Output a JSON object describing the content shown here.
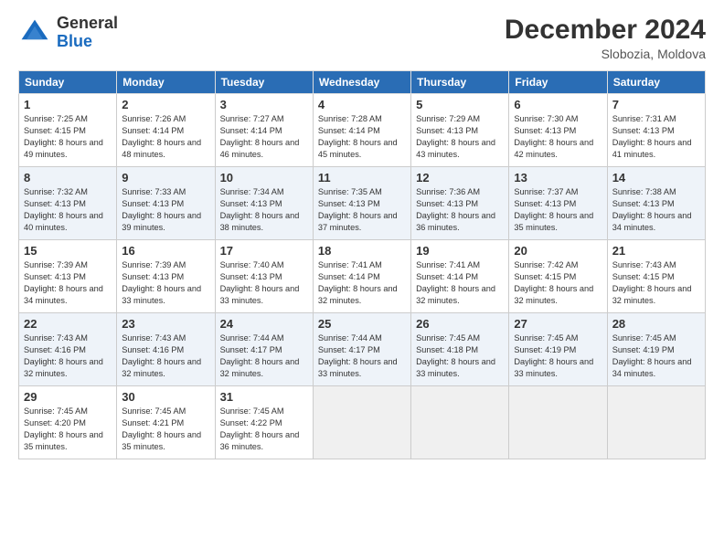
{
  "header": {
    "logo_line1": "General",
    "logo_line2": "Blue",
    "month": "December 2024",
    "location": "Slobozia, Moldova"
  },
  "days_of_week": [
    "Sunday",
    "Monday",
    "Tuesday",
    "Wednesday",
    "Thursday",
    "Friday",
    "Saturday"
  ],
  "weeks": [
    [
      {
        "day": 1,
        "sunrise": "7:25 AM",
        "sunset": "4:15 PM",
        "daylight": "8 hours and 49 minutes."
      },
      {
        "day": 2,
        "sunrise": "7:26 AM",
        "sunset": "4:14 PM",
        "daylight": "8 hours and 48 minutes."
      },
      {
        "day": 3,
        "sunrise": "7:27 AM",
        "sunset": "4:14 PM",
        "daylight": "8 hours and 46 minutes."
      },
      {
        "day": 4,
        "sunrise": "7:28 AM",
        "sunset": "4:14 PM",
        "daylight": "8 hours and 45 minutes."
      },
      {
        "day": 5,
        "sunrise": "7:29 AM",
        "sunset": "4:13 PM",
        "daylight": "8 hours and 43 minutes."
      },
      {
        "day": 6,
        "sunrise": "7:30 AM",
        "sunset": "4:13 PM",
        "daylight": "8 hours and 42 minutes."
      },
      {
        "day": 7,
        "sunrise": "7:31 AM",
        "sunset": "4:13 PM",
        "daylight": "8 hours and 41 minutes."
      }
    ],
    [
      {
        "day": 8,
        "sunrise": "7:32 AM",
        "sunset": "4:13 PM",
        "daylight": "8 hours and 40 minutes."
      },
      {
        "day": 9,
        "sunrise": "7:33 AM",
        "sunset": "4:13 PM",
        "daylight": "8 hours and 39 minutes."
      },
      {
        "day": 10,
        "sunrise": "7:34 AM",
        "sunset": "4:13 PM",
        "daylight": "8 hours and 38 minutes."
      },
      {
        "day": 11,
        "sunrise": "7:35 AM",
        "sunset": "4:13 PM",
        "daylight": "8 hours and 37 minutes."
      },
      {
        "day": 12,
        "sunrise": "7:36 AM",
        "sunset": "4:13 PM",
        "daylight": "8 hours and 36 minutes."
      },
      {
        "day": 13,
        "sunrise": "7:37 AM",
        "sunset": "4:13 PM",
        "daylight": "8 hours and 35 minutes."
      },
      {
        "day": 14,
        "sunrise": "7:38 AM",
        "sunset": "4:13 PM",
        "daylight": "8 hours and 34 minutes."
      }
    ],
    [
      {
        "day": 15,
        "sunrise": "7:39 AM",
        "sunset": "4:13 PM",
        "daylight": "8 hours and 34 minutes."
      },
      {
        "day": 16,
        "sunrise": "7:39 AM",
        "sunset": "4:13 PM",
        "daylight": "8 hours and 33 minutes."
      },
      {
        "day": 17,
        "sunrise": "7:40 AM",
        "sunset": "4:13 PM",
        "daylight": "8 hours and 33 minutes."
      },
      {
        "day": 18,
        "sunrise": "7:41 AM",
        "sunset": "4:14 PM",
        "daylight": "8 hours and 32 minutes."
      },
      {
        "day": 19,
        "sunrise": "7:41 AM",
        "sunset": "4:14 PM",
        "daylight": "8 hours and 32 minutes."
      },
      {
        "day": 20,
        "sunrise": "7:42 AM",
        "sunset": "4:15 PM",
        "daylight": "8 hours and 32 minutes."
      },
      {
        "day": 21,
        "sunrise": "7:43 AM",
        "sunset": "4:15 PM",
        "daylight": "8 hours and 32 minutes."
      }
    ],
    [
      {
        "day": 22,
        "sunrise": "7:43 AM",
        "sunset": "4:16 PM",
        "daylight": "8 hours and 32 minutes."
      },
      {
        "day": 23,
        "sunrise": "7:43 AM",
        "sunset": "4:16 PM",
        "daylight": "8 hours and 32 minutes."
      },
      {
        "day": 24,
        "sunrise": "7:44 AM",
        "sunset": "4:17 PM",
        "daylight": "8 hours and 32 minutes."
      },
      {
        "day": 25,
        "sunrise": "7:44 AM",
        "sunset": "4:17 PM",
        "daylight": "8 hours and 33 minutes."
      },
      {
        "day": 26,
        "sunrise": "7:45 AM",
        "sunset": "4:18 PM",
        "daylight": "8 hours and 33 minutes."
      },
      {
        "day": 27,
        "sunrise": "7:45 AM",
        "sunset": "4:19 PM",
        "daylight": "8 hours and 33 minutes."
      },
      {
        "day": 28,
        "sunrise": "7:45 AM",
        "sunset": "4:19 PM",
        "daylight": "8 hours and 34 minutes."
      }
    ],
    [
      {
        "day": 29,
        "sunrise": "7:45 AM",
        "sunset": "4:20 PM",
        "daylight": "8 hours and 35 minutes."
      },
      {
        "day": 30,
        "sunrise": "7:45 AM",
        "sunset": "4:21 PM",
        "daylight": "8 hours and 35 minutes."
      },
      {
        "day": 31,
        "sunrise": "7:45 AM",
        "sunset": "4:22 PM",
        "daylight": "8 hours and 36 minutes."
      },
      null,
      null,
      null,
      null
    ]
  ]
}
